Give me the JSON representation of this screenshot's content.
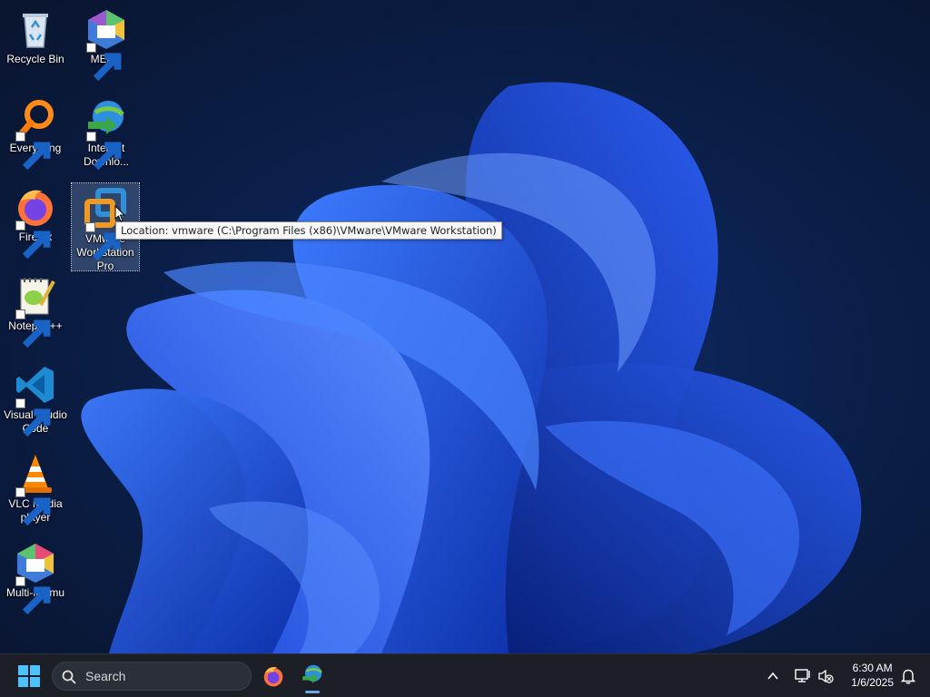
{
  "desktop": {
    "icons": [
      {
        "name": "Recycle Bin",
        "icon": "recycle-bin-icon"
      },
      {
        "name": "MEmu",
        "icon": "memu-icon"
      },
      {
        "name": "Everything",
        "icon": "everything-search-icon"
      },
      {
        "name": "Internet Downlo...",
        "icon": "internet-download-manager-icon"
      },
      {
        "name": "Firefox",
        "icon": "firefox-icon"
      },
      {
        "name": "VMware Workstation Pro",
        "icon": "vmware-workstation-icon"
      },
      {
        "name": "Notepad++",
        "icon": "notepad-plus-plus-icon"
      },
      {
        "name": "Visual Studio Code",
        "icon": "vscode-icon"
      },
      {
        "name": "VLC media player",
        "icon": "vlc-icon"
      },
      {
        "name": "Multi-MEmu",
        "icon": "multi-memu-icon"
      }
    ],
    "tooltip": "Location: vmware (C:\\Program Files (x86)\\VMware\\VMware Workstation)",
    "selected_icon": "VMware Workstation Pro"
  },
  "taskbar": {
    "start_icon": "windows-start-icon",
    "search_placeholder": "Search",
    "pinned": [
      {
        "name": "Firefox",
        "icon": "firefox-icon",
        "running": false
      },
      {
        "name": "Internet Download Manager",
        "icon": "internet-download-manager-icon",
        "running": true
      }
    ],
    "tray": {
      "icons": [
        "chevron-up-icon",
        "network-icon",
        "volume-muted-icon",
        "notification-bell-icon"
      ],
      "time": "6:30 AM",
      "date": "1/6/2025"
    }
  },
  "colors": {
    "wallpaper_dark": "#081a3a",
    "bloom_blue": "#1f4fe0",
    "taskbar_bg": "#1c1f26"
  }
}
